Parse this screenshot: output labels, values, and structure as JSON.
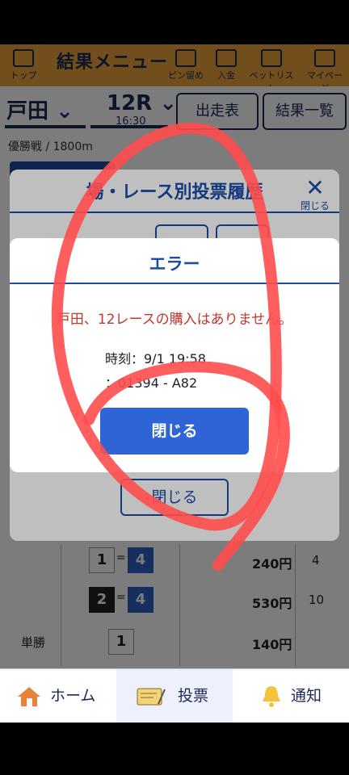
{
  "header": {
    "title": "結果メニュー",
    "nav": [
      {
        "label": "トップ",
        "icon": "home-icon"
      },
      {
        "label": "ピン留め",
        "icon": "pin-icon"
      },
      {
        "label": "入金",
        "icon": "wallet-icon"
      },
      {
        "label": "ベットリスト",
        "icon": "list-icon"
      },
      {
        "label": "マイページ",
        "icon": "menu-icon"
      }
    ]
  },
  "selector": {
    "venue": "戸田",
    "race": "12R",
    "race_time": "16:30",
    "entry_button": "出走表",
    "results_button": "結果一覧"
  },
  "race_info": "優勝戦 / 1800m",
  "results": {
    "rows": [
      {
        "label": "",
        "combo_a": "1",
        "combo_b": "4",
        "amount": "240円",
        "pop": "4"
      },
      {
        "label": "",
        "combo_a": "2",
        "combo_b": "4",
        "amount": "530円",
        "pop": "10"
      },
      {
        "label": "単勝",
        "combo_a": "1",
        "combo_b": "",
        "amount": "140円",
        "pop": ""
      }
    ]
  },
  "bottom_nav": {
    "home": "ホーム",
    "bet": "投票",
    "notify": "通知"
  },
  "history_modal": {
    "title": "場・レース別投票履歴",
    "close_icon_label": "閉じる",
    "close_button": "閉じる"
  },
  "error_modal": {
    "title": "エラー",
    "message": "戸田、12レースの購入はありません。",
    "time_line": "時刻：9/1 19:58",
    "code_line": "：01394 - A82",
    "close_button": "閉じる"
  },
  "colors": {
    "brand_orange": "#e9a23a",
    "navy": "#1b2a57",
    "primary_blue": "#2f64d6",
    "error_red": "#c0392b",
    "annotation_red": "#ff4d4d"
  }
}
